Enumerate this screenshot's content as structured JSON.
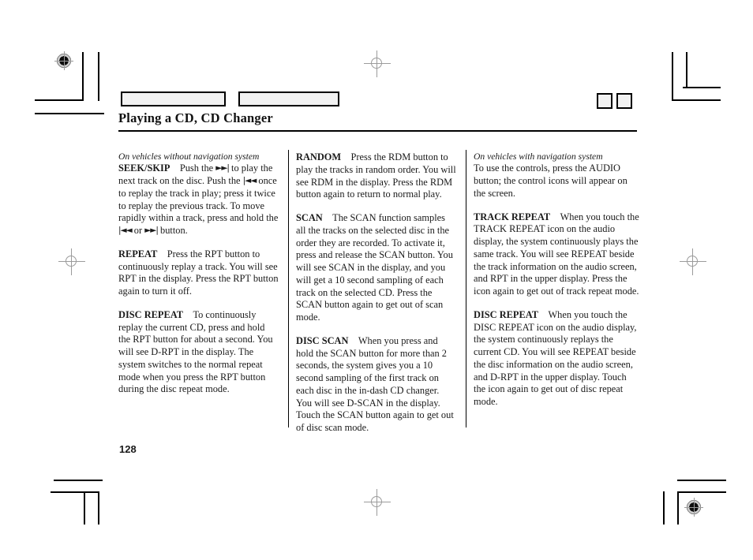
{
  "document": {
    "page_title": "Playing a CD, CD Changer",
    "page_number": "128"
  },
  "header_boxes": [
    {
      "name": "header-tab-box-1",
      "label": ""
    },
    {
      "name": "header-tab-box-2",
      "label": ""
    }
  ],
  "corner_boxes": [
    {
      "name": "corner-box-1",
      "label": ""
    },
    {
      "name": "corner-box-2",
      "label": ""
    }
  ],
  "columns": {
    "left": {
      "note": "On vehicles without navigation system",
      "paragraphs": [
        {
          "term": "SEEK/SKIP",
          "body_1": "Push the ",
          "glyph_1": "►►|",
          "body_2": " to play the next track on the disc. Push the ",
          "glyph_2": "|◄◄",
          "body_3": " once to replay the track in play; press it twice to replay the previous track. To move rapidly within a track, press and hold the ",
          "glyph_3": "|◄◄",
          "body_4": " or ",
          "glyph_4": "►►|",
          "body_5": " button."
        },
        {
          "term": "REPEAT",
          "text": "Press the RPT button to continuously replay a track. You will see RPT in the display. Press the RPT button again to turn it off."
        },
        {
          "term": "DISC REPEAT",
          "text": "To continuously replay the current CD, press and hold the RPT button for about a second. You will see D-RPT in the display. The system switches to the normal repeat mode when you press the RPT button during the disc repeat mode."
        }
      ]
    },
    "middle": {
      "paragraphs": [
        {
          "term": "RANDOM",
          "text": "Press the RDM button to play the tracks in random order. You will see RDM in the display. Press the RDM button again to return to normal play."
        },
        {
          "term": "SCAN",
          "text": "The SCAN function samples all the tracks on the selected disc in the order they are recorded. To activate it, press and release the SCAN button. You will see SCAN in the display, and you will get a 10 second sampling of each track on the selected CD. Press the SCAN button again to get out of scan mode."
        },
        {
          "term": "DISC SCAN",
          "text": "When you press and hold the SCAN button for more than 2 seconds, the system gives you a 10 second sampling of the first track on each disc in the in-dash CD changer. You will see D-SCAN in the display. Touch the SCAN button again to get out of disc scan mode."
        }
      ]
    },
    "right": {
      "note": "On vehicles with navigation system",
      "intro": "To use the controls, press the AUDIO button; the control icons will appear on the screen.",
      "paragraphs": [
        {
          "term": "TRACK REPEAT",
          "text": "When you touch the TRACK REPEAT icon on the audio display, the system continuously plays the same track. You will see REPEAT beside the track information on the audio screen, and RPT in the upper display. Press the icon again to get out of track repeat mode."
        },
        {
          "term": "DISC REPEAT",
          "text": "When you touch the DISC REPEAT icon on the audio display, the system continuously replays the current CD. You will see REPEAT beside the disc information on the audio screen, and D-RPT in the upper display. Touch the icon again to get out of disc repeat mode."
        }
      ]
    }
  }
}
